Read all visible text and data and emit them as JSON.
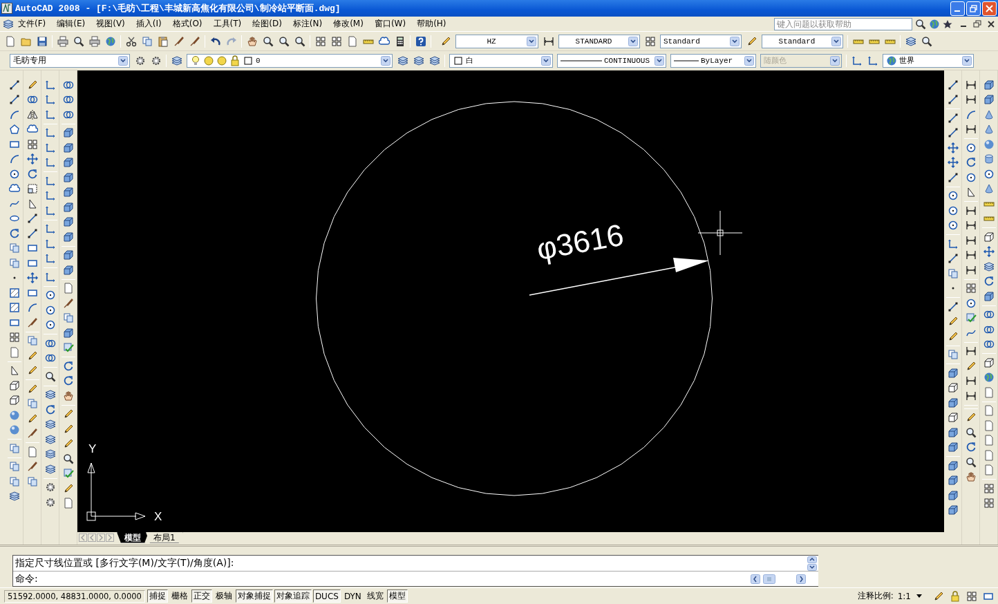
{
  "window": {
    "title": "AutoCAD 2008 - [F:\\毛昉\\工程\\丰城新高焦化有限公司\\制冷站平断面.dwg]"
  },
  "menu": [
    "文件(F)",
    "编辑(E)",
    "视图(V)",
    "插入(I)",
    "格式(O)",
    "工具(T)",
    "绘图(D)",
    "标注(N)",
    "修改(M)",
    "窗口(W)",
    "帮助(H)"
  ],
  "help_search": {
    "placeholder": "键入问题以获取帮助"
  },
  "styles_toolbar": {
    "text_style": "HZ",
    "dim_style": "STANDARD",
    "table_style": "Standard",
    "mleader_style": "Standard"
  },
  "workspace": "毛昉专用",
  "layer": {
    "name": "0"
  },
  "properties_toolbar": {
    "color_name": "白",
    "linetype": "CONTINUOUS",
    "lineweight": "ByLayer",
    "plot_style": {
      "value": "随颜色",
      "disabled": true
    }
  },
  "ucs": {
    "name": "世界"
  },
  "drawing": {
    "dimension_text": "φ3616",
    "axis_x": "X",
    "axis_y": "Y"
  },
  "layout_tabs": [
    {
      "label": "模型",
      "selected": true
    },
    {
      "label": "布局1",
      "selected": false
    }
  ],
  "command": {
    "history": "指定尺寸线位置或 [多行文字(M)/文字(T)/角度(A)]:",
    "prompt": "命令:"
  },
  "status": {
    "coordinates": "51592.0000, 48831.0000, 0.0000",
    "toggles": [
      {
        "label": "捕捉",
        "on": true
      },
      {
        "label": "栅格",
        "on": false
      },
      {
        "label": "正交",
        "on": true
      },
      {
        "label": "极轴",
        "on": false
      },
      {
        "label": "对象捕捉",
        "on": true
      },
      {
        "label": "对象追踪",
        "on": true
      },
      {
        "label": "DUCS",
        "on": true
      },
      {
        "label": "DYN",
        "on": false
      },
      {
        "label": "线宽",
        "on": false
      },
      {
        "label": "模型",
        "on": true
      }
    ],
    "annotation_scale_label": "注释比例:",
    "annotation_scale": "1:1"
  }
}
